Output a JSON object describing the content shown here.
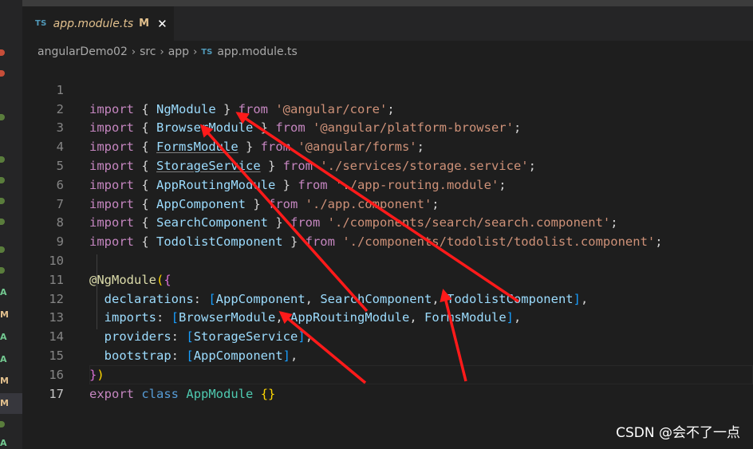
{
  "tab": {
    "lang_badge": "TS",
    "title": "app.module.ts",
    "status": "M",
    "close": "✕"
  },
  "breadcrumb": {
    "items": [
      "angularDemo02",
      "src",
      "app"
    ],
    "file_badge": "TS",
    "file": "app.module.ts",
    "separator": "›"
  },
  "sidebar": {
    "badges": [
      "A",
      "M",
      "A",
      "A",
      "M",
      "M",
      "A"
    ]
  },
  "editor": {
    "line_numbers": [
      "1",
      "2",
      "3",
      "4",
      "5",
      "6",
      "7",
      "8",
      "9",
      "10",
      "11",
      "12",
      "13",
      "14",
      "15",
      "16",
      "17"
    ],
    "active_line": "17"
  },
  "code": {
    "l1": {
      "kw": "import",
      "o": " { ",
      "name": "NgModule",
      "c": " } ",
      "from": "from",
      "sp": " ",
      "str": "'@angular/core'",
      "end": ";"
    },
    "l2": {
      "kw": "import",
      "o": " { ",
      "name": "BrowserModule",
      "c": " } ",
      "from": "from",
      "sp": " ",
      "str": "'@angular/platform-browser'",
      "end": ";"
    },
    "l3": {
      "kw": "import",
      "o": " { ",
      "name": "FormsModule",
      "c": " } ",
      "from": "from",
      "sp": " ",
      "str": "'@angular/forms'",
      "end": ";"
    },
    "l4": {
      "kw": "import",
      "o": " { ",
      "name": "StorageService",
      "c": " } ",
      "from": "from",
      "sp": " ",
      "str": "'./services/storage.service'",
      "end": ";"
    },
    "l5": {
      "kw": "import",
      "o": " { ",
      "name": "AppRoutingModule",
      "c": " } ",
      "from": "from",
      "sp": " ",
      "str": "'./app-routing.module'",
      "end": ";"
    },
    "l6": {
      "kw": "import",
      "o": " { ",
      "name": "AppComponent",
      "c": " } ",
      "from": "from",
      "sp": " ",
      "str": "'./app.component'",
      "end": ";"
    },
    "l7": {
      "kw": "import",
      "o": " { ",
      "name": "SearchComponent",
      "c": " } ",
      "from": "from",
      "sp": " ",
      "str": "'./components/search/search.component'",
      "end": ";"
    },
    "l8": {
      "kw": "import",
      "o": " { ",
      "name": "TodolistComponent",
      "c": " } ",
      "from": "from",
      "sp": " ",
      "str": "'./components/todolist/todolist.component'",
      "end": ";"
    },
    "l10": {
      "at": "@",
      "dec": "NgModule",
      "open": "(",
      "brace": "{"
    },
    "l11": {
      "indent": "  ",
      "prop": "declarations",
      "colon": ": ",
      "ob": "[",
      "a": "AppComponent",
      "comma1": ", ",
      "b": "SearchComponent",
      "comma2": ", ",
      "c": "TodolistComponent",
      "cb": "]",
      "end": ","
    },
    "l12": {
      "indent": "  ",
      "prop": "imports",
      "colon": ": ",
      "ob": "[",
      "a": "BrowserModule",
      "comma1": ", ",
      "b": "AppRoutingModule",
      "comma2": ", ",
      "c": "FormsModule",
      "cb": "]",
      "end": ","
    },
    "l13": {
      "indent": "  ",
      "prop": "providers",
      "colon": ": ",
      "ob": "[",
      "a": "StorageService",
      "cb": "]",
      "end": ","
    },
    "l14": {
      "indent": "  ",
      "prop": "bootstrap",
      "colon": ": ",
      "ob": "[",
      "a": "AppComponent",
      "cb": "]",
      "end": ","
    },
    "l15": {
      "brace": "}",
      "paren": ")"
    },
    "l16": {
      "kw1": "export",
      "sp1": " ",
      "kw2": "class",
      "sp2": " ",
      "name": "AppModule",
      "sp3": " ",
      "body": "{}"
    }
  },
  "watermark": "CSDN @会不了一点",
  "colors": {
    "background": "#1e1e1e",
    "keyword_import": "#c586c0",
    "keyword": "#569cd6",
    "class_name": "#4ec9b0",
    "string": "#ce9178",
    "property": "#9cdcfe",
    "decorator": "#dcdcaa",
    "annotation_arrow": "#ff1a1a",
    "modified": "#e2c08d",
    "added": "#73c991"
  }
}
